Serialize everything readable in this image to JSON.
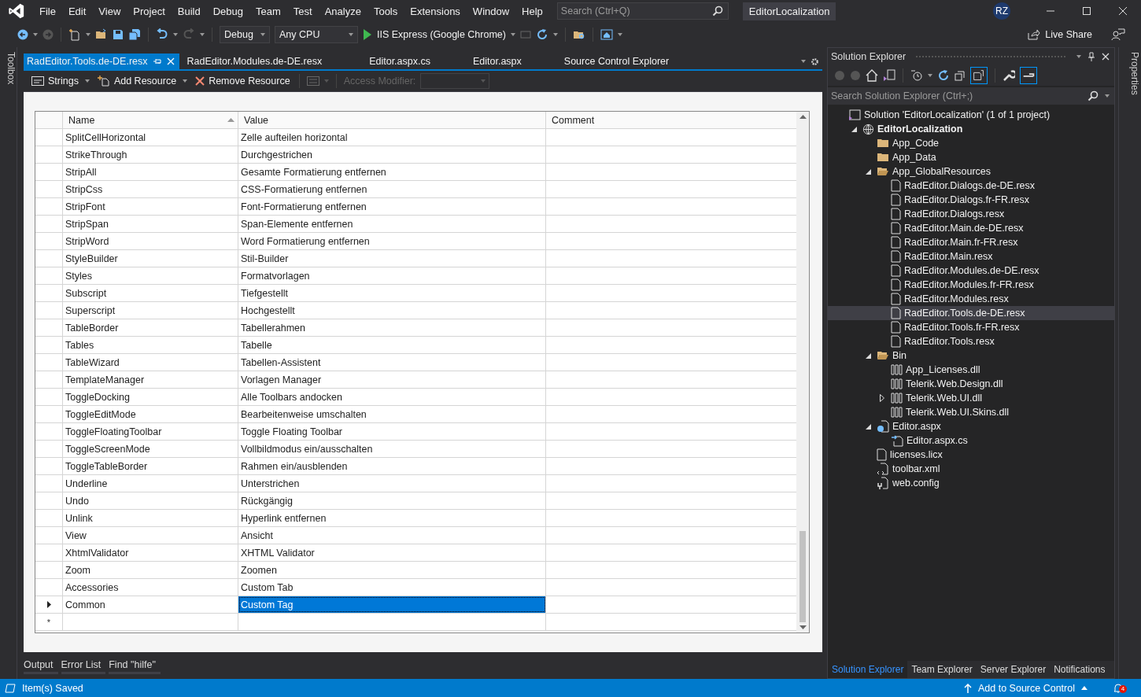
{
  "menu": [
    "File",
    "Edit",
    "View",
    "Project",
    "Build",
    "Debug",
    "Team",
    "Test",
    "Analyze",
    "Tools",
    "Extensions",
    "Window",
    "Help"
  ],
  "search": {
    "placeholder": "Search (Ctrl+Q)"
  },
  "solution_name": "EditorLocalization",
  "avatar": "RZ",
  "toolbar": {
    "configuration": "Debug",
    "platform": "Any CPU",
    "run_target": "IIS Express (Google Chrome)",
    "live_share": "Live Share"
  },
  "toolbox_label": "Toolbox",
  "properties_label": "Properties",
  "doc_tabs": [
    {
      "label": "RadEditor.Tools.de-DE.resx",
      "selected": true
    },
    {
      "label": "RadEditor.Modules.de-DE.resx",
      "selected": false
    },
    {
      "label": "Editor.aspx.cs",
      "selected": false
    },
    {
      "label": "Editor.aspx",
      "selected": false
    },
    {
      "label": "Source Control Explorer",
      "selected": false
    }
  ],
  "resource_toolbar": {
    "strings": "Strings",
    "add": "Add Resource",
    "remove": "Remove Resource",
    "access_modifier": "Access Modifier:"
  },
  "grid": {
    "columns": [
      "Name",
      "Value",
      "Comment"
    ],
    "new_row_marker": "*",
    "rows": [
      {
        "name": "SplitCellHorizontal",
        "value": "Zelle aufteilen horizontal",
        "selected": false
      },
      {
        "name": "StrikeThrough",
        "value": "Durchgestrichen",
        "selected": false
      },
      {
        "name": "StripAll",
        "value": "Gesamte Formatierung entfernen",
        "selected": false
      },
      {
        "name": "StripCss",
        "value": "CSS-Formatierung entfernen",
        "selected": false
      },
      {
        "name": "StripFont",
        "value": "Font-Formatierung entfernen",
        "selected": false
      },
      {
        "name": "StripSpan",
        "value": "Span-Elemente entfernen",
        "selected": false
      },
      {
        "name": "StripWord",
        "value": "Word Formatierung entfernen",
        "selected": false
      },
      {
        "name": "StyleBuilder",
        "value": "Stil-Builder",
        "selected": false
      },
      {
        "name": "Styles",
        "value": "Formatvorlagen",
        "selected": false
      },
      {
        "name": "Subscript",
        "value": "Tiefgestellt",
        "selected": false
      },
      {
        "name": "Superscript",
        "value": "Hochgestellt",
        "selected": false
      },
      {
        "name": "TableBorder",
        "value": "Tabellerahmen",
        "selected": false
      },
      {
        "name": "Tables",
        "value": "Tabelle",
        "selected": false
      },
      {
        "name": "TableWizard",
        "value": "Tabellen-Assistent",
        "selected": false
      },
      {
        "name": "TemplateManager",
        "value": "Vorlagen Manager",
        "selected": false
      },
      {
        "name": "ToggleDocking",
        "value": "Alle Toolbars andocken",
        "selected": false
      },
      {
        "name": "ToggleEditMode",
        "value": "Bearbeitenweise umschalten",
        "selected": false
      },
      {
        "name": "ToggleFloatingToolbar",
        "value": "Toggle Floating Toolbar",
        "selected": false
      },
      {
        "name": "ToggleScreenMode",
        "value": "Vollbildmodus ein/ausschalten",
        "selected": false
      },
      {
        "name": "ToggleTableBorder",
        "value": "Rahmen ein/ausblenden",
        "selected": false
      },
      {
        "name": "Underline",
        "value": "Unterstrichen",
        "selected": false
      },
      {
        "name": "Undo",
        "value": "Rückgängig",
        "selected": false
      },
      {
        "name": "Unlink",
        "value": "Hyperlink entfernen",
        "selected": false
      },
      {
        "name": "View",
        "value": "Ansicht",
        "selected": false
      },
      {
        "name": "XhtmlValidator",
        "value": "XHTML Validator",
        "selected": false
      },
      {
        "name": "Zoom",
        "value": "Zoomen",
        "selected": false
      },
      {
        "name": "Accessories",
        "value": "Custom Tab",
        "selected": false
      },
      {
        "name": "Common",
        "value": "Custom Tag",
        "selected": true
      }
    ]
  },
  "solution_explorer": {
    "title": "Solution Explorer",
    "search": {
      "placeholder": "Search Solution Explorer (Ctrl+;)"
    },
    "tree": [
      {
        "label": "Solution 'EditorLocalization' (1 of 1 project)",
        "kind": "solution",
        "selected": false,
        "children": [
          {
            "label": "EditorLocalization",
            "kind": "project",
            "expanded": true,
            "selected": false,
            "children": [
              {
                "label": "App_Code",
                "kind": "folder",
                "selected": false
              },
              {
                "label": "App_Data",
                "kind": "folder",
                "selected": false
              },
              {
                "label": "App_GlobalResources",
                "kind": "folder",
                "expanded": true,
                "selected": false,
                "children": [
                  {
                    "label": "RadEditor.Dialogs.de-DE.resx",
                    "kind": "file",
                    "selected": false
                  },
                  {
                    "label": "RadEditor.Dialogs.fr-FR.resx",
                    "kind": "file",
                    "selected": false
                  },
                  {
                    "label": "RadEditor.Dialogs.resx",
                    "kind": "file",
                    "selected": false
                  },
                  {
                    "label": "RadEditor.Main.de-DE.resx",
                    "kind": "file",
                    "selected": false
                  },
                  {
                    "label": "RadEditor.Main.fr-FR.resx",
                    "kind": "file",
                    "selected": false
                  },
                  {
                    "label": "RadEditor.Main.resx",
                    "kind": "file",
                    "selected": false
                  },
                  {
                    "label": "RadEditor.Modules.de-DE.resx",
                    "kind": "file",
                    "selected": false
                  },
                  {
                    "label": "RadEditor.Modules.fr-FR.resx",
                    "kind": "file",
                    "selected": false
                  },
                  {
                    "label": "RadEditor.Modules.resx",
                    "kind": "file",
                    "selected": false
                  },
                  {
                    "label": "RadEditor.Tools.de-DE.resx",
                    "kind": "file",
                    "selected": true
                  },
                  {
                    "label": "RadEditor.Tools.fr-FR.resx",
                    "kind": "file",
                    "selected": false
                  },
                  {
                    "label": "RadEditor.Tools.resx",
                    "kind": "file",
                    "selected": false
                  }
                ]
              },
              {
                "label": "Bin",
                "kind": "folder",
                "expanded": true,
                "selected": false,
                "children": [
                  {
                    "label": "App_Licenses.dll",
                    "kind": "dll",
                    "selected": false
                  },
                  {
                    "label": "Telerik.Web.Design.dll",
                    "kind": "dll",
                    "selected": false
                  },
                  {
                    "label": "Telerik.Web.UI.dll",
                    "kind": "dll",
                    "expanded": false,
                    "selected": false
                  },
                  {
                    "label": "Telerik.Web.UI.Skins.dll",
                    "kind": "dll",
                    "selected": false
                  }
                ]
              },
              {
                "label": "Editor.aspx",
                "kind": "page",
                "expanded": true,
                "selected": false,
                "children": [
                  {
                    "label": "Editor.aspx.cs",
                    "kind": "code",
                    "selected": false
                  }
                ]
              },
              {
                "label": "licenses.licx",
                "kind": "plainfile",
                "selected": false
              },
              {
                "label": "toolbar.xml",
                "kind": "xml",
                "selected": false
              },
              {
                "label": "web.config",
                "kind": "config",
                "selected": false
              }
            ]
          }
        ]
      }
    ]
  },
  "side_tabs": [
    {
      "label": "Solution Explorer",
      "selected": true
    },
    {
      "label": "Team Explorer",
      "selected": false
    },
    {
      "label": "Server Explorer",
      "selected": false
    },
    {
      "label": "Notifications",
      "selected": false
    }
  ],
  "bottom_tabs": [
    "Output",
    "Error List",
    "Find \"hilfe\""
  ],
  "status_bar": {
    "message": "Item(s) Saved",
    "source_control": "Add to Source Control",
    "notifications": "4"
  }
}
